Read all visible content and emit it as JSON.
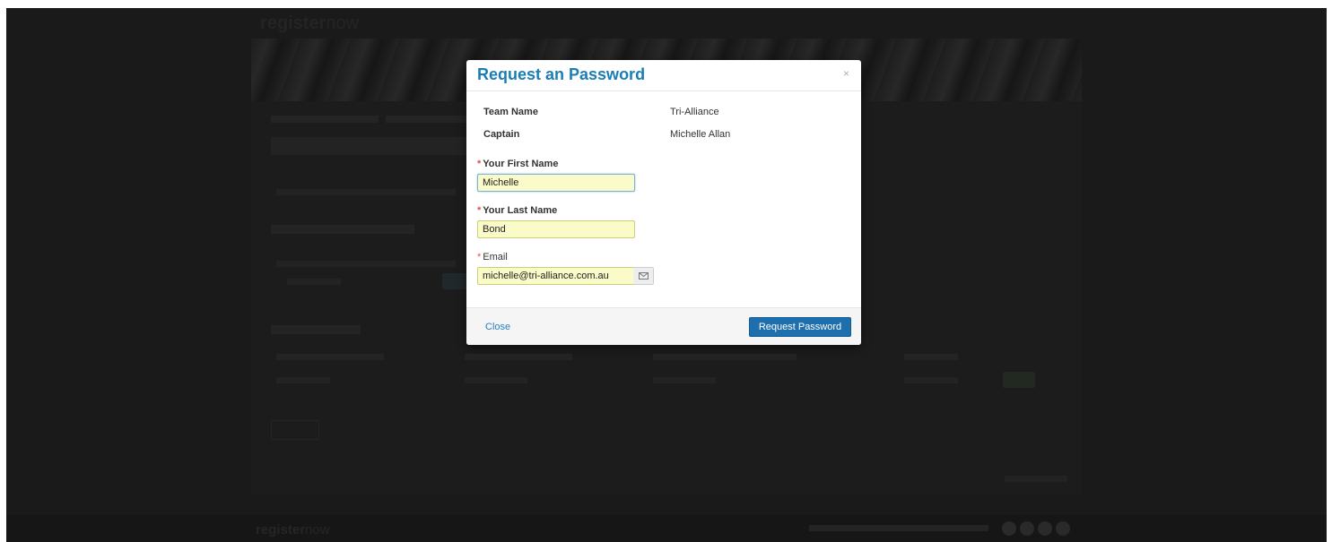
{
  "background": {
    "logo_bold": "register",
    "logo_light": "now",
    "footer_logo_bold": "register",
    "footer_logo_light": "now"
  },
  "modal": {
    "title": "Request an Password",
    "close_glyph": "×",
    "info": {
      "team_name_label": "Team Name",
      "team_name_value": "Tri-Alliance",
      "captain_label": "Captain",
      "captain_value": "Michelle Allan"
    },
    "form": {
      "required_marker": "*",
      "first_name_label": "Your First Name",
      "first_name_value": "Michelle",
      "last_name_label": "Your Last Name",
      "last_name_value": "Bond",
      "email_label": "Email",
      "email_value": "michelle@tri-alliance.com.au",
      "email_icon": "envelope-icon"
    },
    "footer": {
      "close_label": "Close",
      "submit_label": "Request Password"
    }
  },
  "colors": {
    "title": "#1a7db5",
    "primary_button": "#1e6fad",
    "input_fill": "#fafbc8",
    "required": "#d9534f",
    "overlay": "#1a1a1a"
  }
}
